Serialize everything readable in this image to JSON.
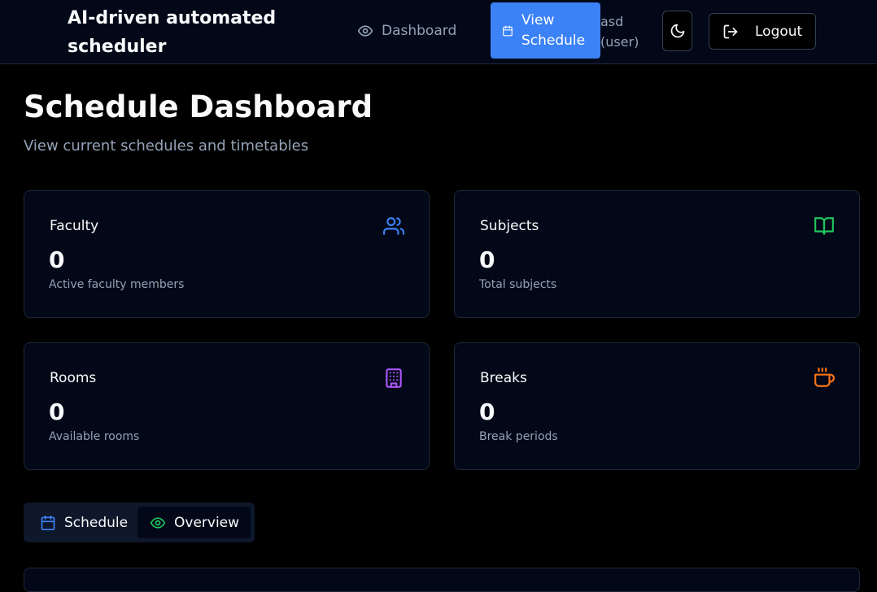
{
  "header": {
    "app_title": "AI-driven automated scheduler",
    "nav": {
      "dashboard_label": "Dashboard",
      "view_schedule_label": "View Schedule"
    },
    "user_label": "asd (user)",
    "logout_label": "Logout",
    "icons": [
      "eye-icon",
      "calendar-icon",
      "moon-icon",
      "logout-icon"
    ]
  },
  "page": {
    "title": "Schedule Dashboard",
    "subtitle": "View current schedules and timetables"
  },
  "stats": [
    {
      "title": "Faculty",
      "value": "0",
      "description": "Active faculty members",
      "icon": "users-icon",
      "color": "#3b82f6"
    },
    {
      "title": "Subjects",
      "value": "0",
      "description": "Total subjects",
      "icon": "book-open-icon",
      "color": "#22c55e"
    },
    {
      "title": "Rooms",
      "value": "0",
      "description": "Available rooms",
      "icon": "building-icon",
      "color": "#a855f7"
    },
    {
      "title": "Breaks",
      "value": "0",
      "description": "Break periods",
      "icon": "coffee-icon",
      "color": "#f97316"
    }
  ],
  "tabs": {
    "schedule_label": "Schedule",
    "overview_label": "Overview",
    "active": "Overview"
  },
  "colors": {
    "accent": "#3b82f6",
    "background": "#000000",
    "card_bg": "#020817",
    "muted_text": "#94a3b8"
  }
}
